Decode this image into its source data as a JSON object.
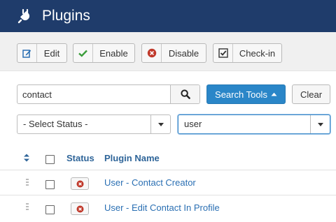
{
  "header": {
    "title": "Plugins",
    "icon": "plug-icon"
  },
  "toolbar": {
    "edit_label": "Edit",
    "enable_label": "Enable",
    "disable_label": "Disable",
    "checkin_label": "Check-in"
  },
  "search": {
    "value": "contact",
    "tools_label": "Search Tools",
    "clear_label": "Clear"
  },
  "filters": {
    "status": "- Select Status -",
    "folder": "user"
  },
  "table": {
    "headers": {
      "status": "Status",
      "name": "Plugin Name"
    },
    "rows": [
      {
        "name": "User - Contact Creator",
        "status": "disabled"
      },
      {
        "name": "User - Edit Contact In Profile",
        "status": "disabled"
      }
    ]
  },
  "colors": {
    "header_bg": "#1f3c6b",
    "primary": "#2a86c8",
    "link": "#2a6fb3",
    "disabled_icon": "#c0392b"
  }
}
